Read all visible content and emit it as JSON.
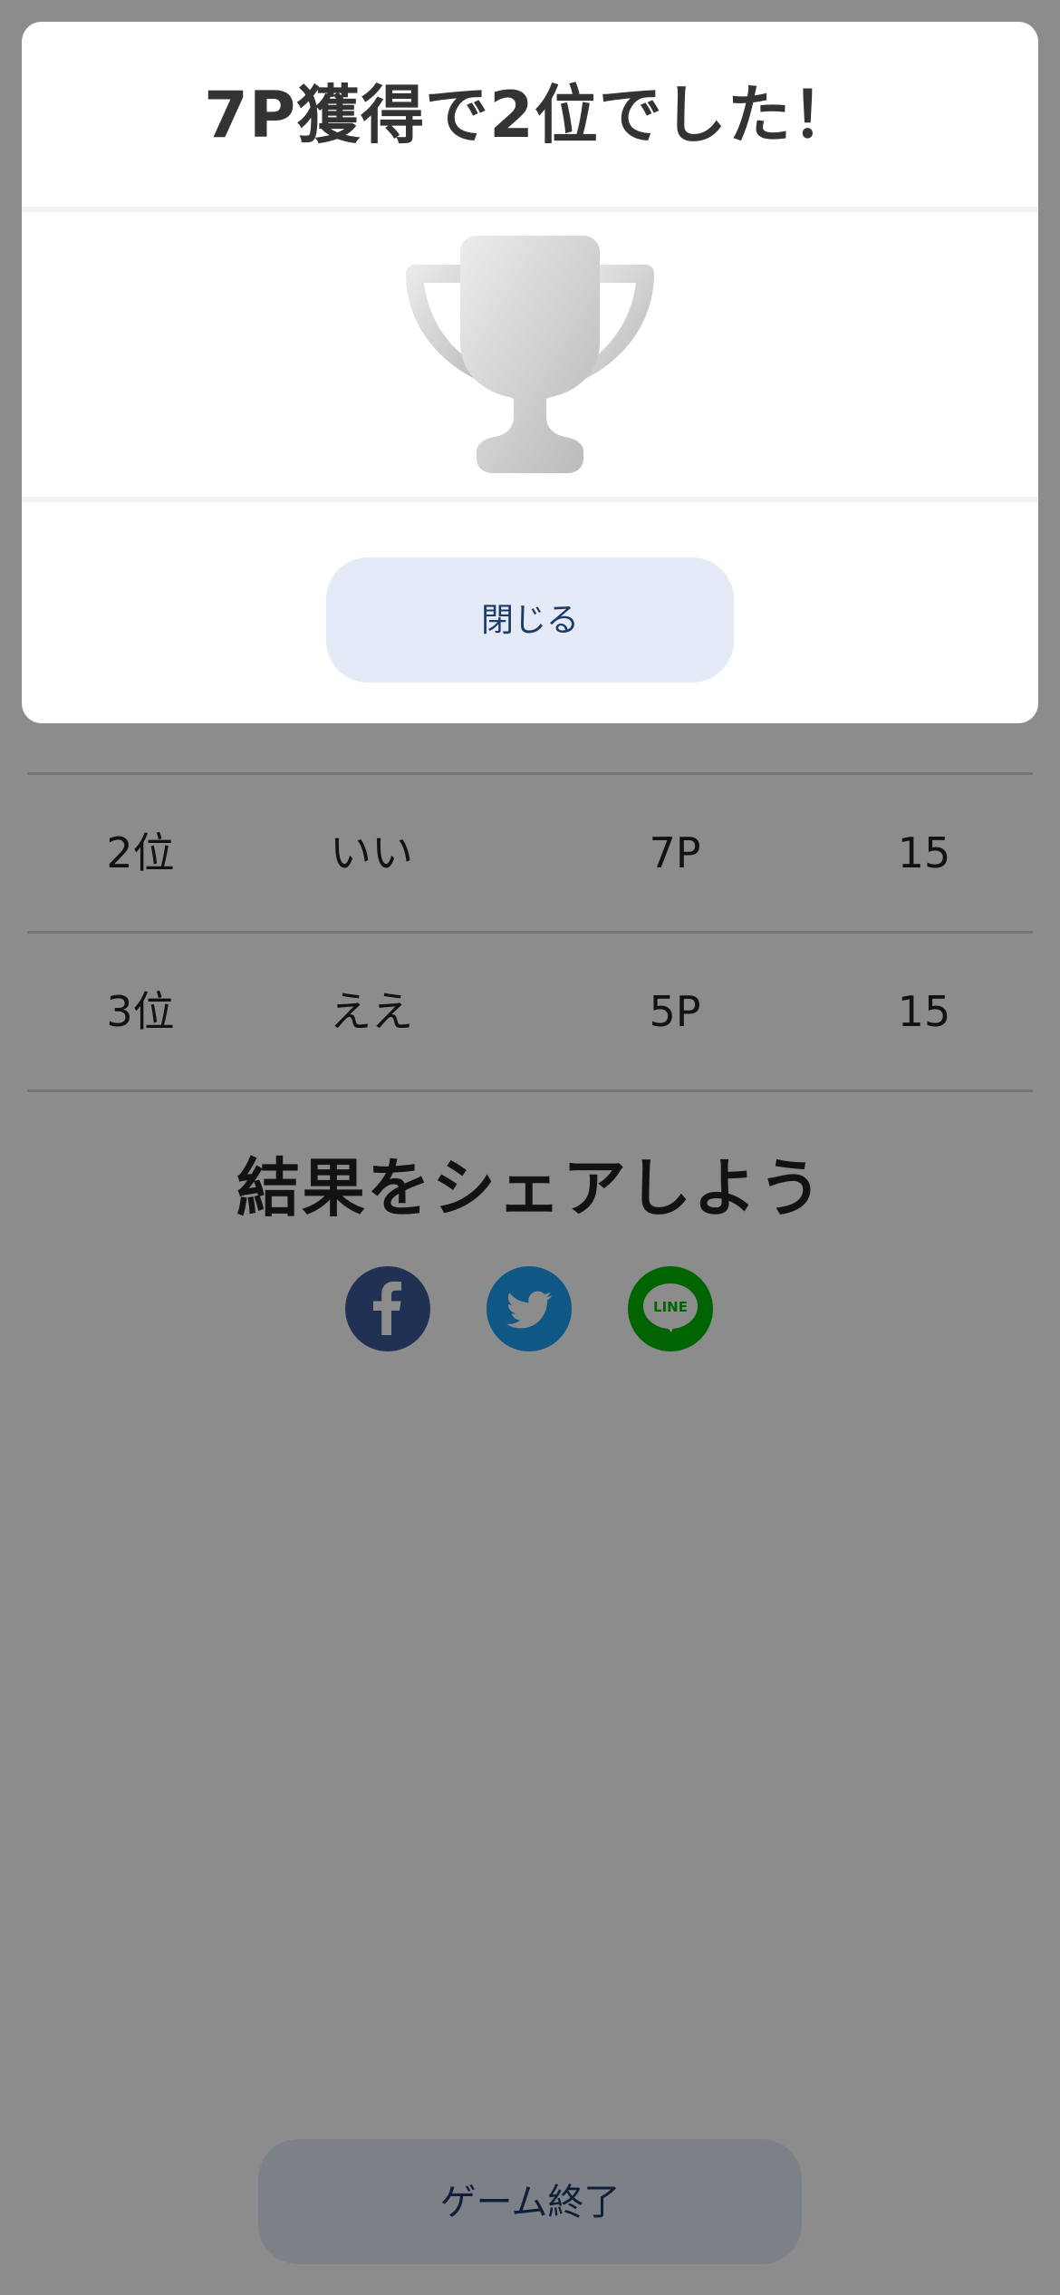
{
  "results": {
    "rows": [
      {
        "rank": "2位",
        "name": "いい",
        "points": "7P",
        "count": "15"
      },
      {
        "rank": "3位",
        "name": "ええ",
        "points": "5P",
        "count": "15"
      }
    ]
  },
  "share": {
    "title": "結果をシェアしよう",
    "icons": [
      "facebook-icon",
      "twitter-icon",
      "line-icon"
    ],
    "colors": {
      "facebook": "#3b5998",
      "twitter": "#1da1f2",
      "line": "#00b900"
    },
    "line_label": "LINE"
  },
  "footer": {
    "end_label": "ゲーム終了"
  },
  "modal": {
    "title": "7P獲得で2位でした！",
    "icon": "trophy-icon",
    "close_label": "閉じる"
  }
}
